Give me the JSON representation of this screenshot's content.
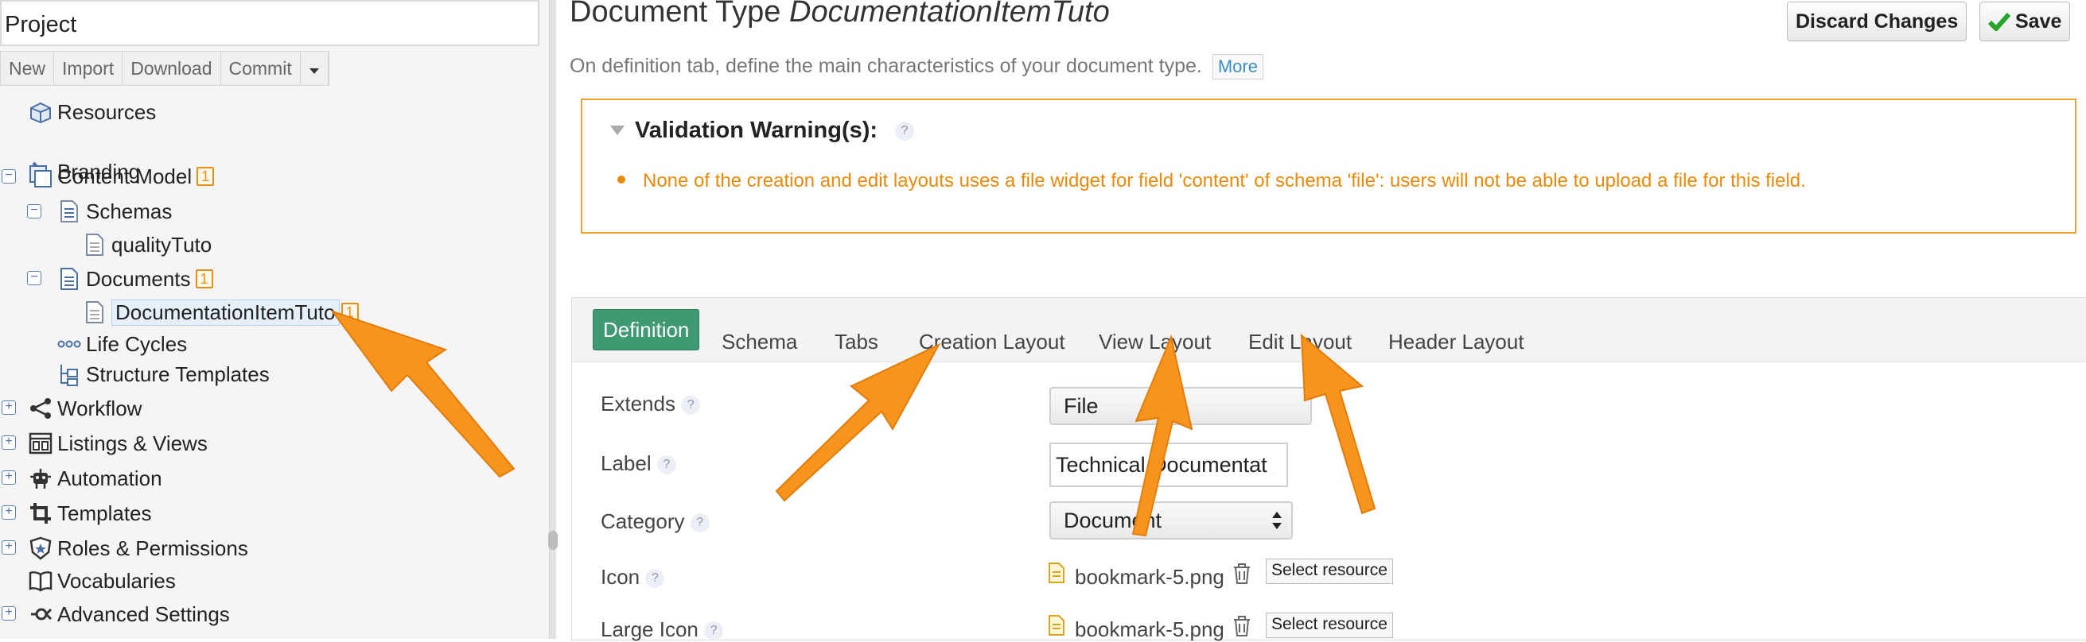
{
  "sidebar": {
    "project_value": "Project",
    "toolbar": [
      "New",
      "Import",
      "Download",
      "Commit"
    ],
    "tree": {
      "resources": "Resources",
      "branding": "Branding",
      "content_model": "Content Model",
      "content_model_badge": "1",
      "schemas": "Schemas",
      "quality": "qualityTuto",
      "documents": "Documents",
      "documents_badge": "1",
      "doc_item": "DocumentationItemTuto",
      "doc_item_badge": "1",
      "life_cycles": "Life Cycles",
      "structure_templates": "Structure Templates",
      "workflow": "Workflow",
      "listings": "Listings & Views",
      "automation": "Automation",
      "templates": "Templates",
      "roles": "Roles & Permissions",
      "vocabularies": "Vocabularies",
      "advanced": "Advanced Settings"
    }
  },
  "header": {
    "title_prefix": "Document Type ",
    "title_name": "DocumentationItemTuto",
    "discard_label": "Discard Changes",
    "save_label": "Save",
    "description": "On definition tab, define the main characteristics of your document type.",
    "more_label": "More"
  },
  "validation": {
    "title": "Validation Warning(s):",
    "help": "?",
    "message": "None of the creation and edit layouts uses a file widget for field 'content' of schema 'file': users will not be able to upload a file for this field."
  },
  "tabs": [
    "Definition",
    "Schema",
    "Tabs",
    "Creation Layout",
    "View Layout",
    "Edit Layout",
    "Header Layout"
  ],
  "form": {
    "extends_label": "Extends",
    "extends_value": "File",
    "label_label": "Label",
    "label_value": "Technical Documentat",
    "category_label": "Category",
    "category_value": "Document",
    "icon_label": "Icon",
    "icon_file": "bookmark-5.png",
    "large_icon_label": "Large Icon",
    "large_icon_file": "bookmark-5.png",
    "select_resource": "Select resource",
    "help": "?"
  },
  "colors": {
    "accent_green": "#3f9a73",
    "warning_orange": "#e88a0c",
    "annotation_arrow": "#f7941d"
  }
}
